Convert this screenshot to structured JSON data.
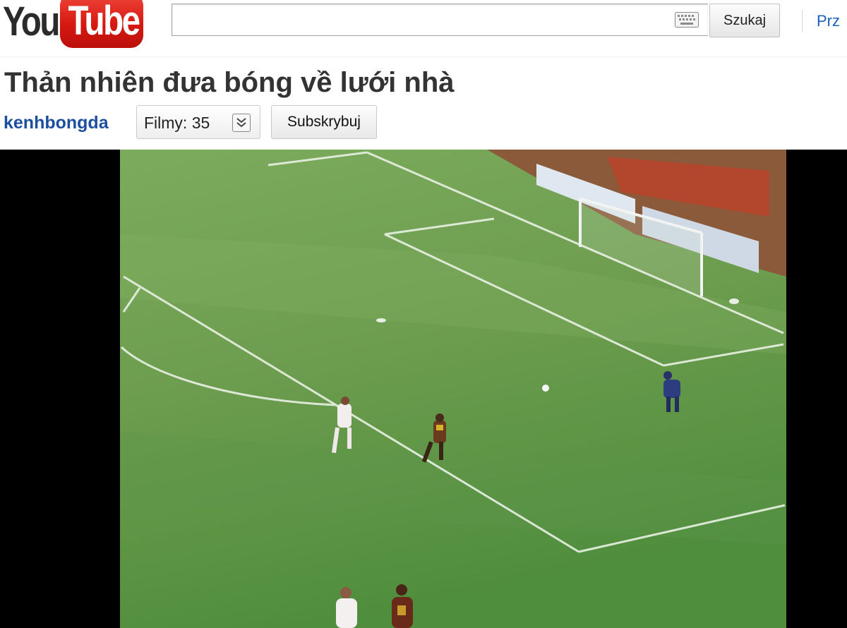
{
  "masthead": {
    "logo_you": "You",
    "logo_tube": "Tube",
    "search_value": "",
    "search_button": "Szukaj",
    "right_link": "Prz"
  },
  "video": {
    "title": "Thản nhiên đưa bóng về lưới nhà"
  },
  "channel": {
    "name": "kenhbongda",
    "videos_label": "Filmy: 35",
    "subscribe_label": "Subskrybuj"
  },
  "colors": {
    "logo_red": "#d71a12",
    "link_blue": "#1c4fa0",
    "pitch_green": "#6f9e4f",
    "player_bg": "#000000"
  },
  "icons": [
    "keyboard-icon",
    "chevron-down-icon"
  ]
}
